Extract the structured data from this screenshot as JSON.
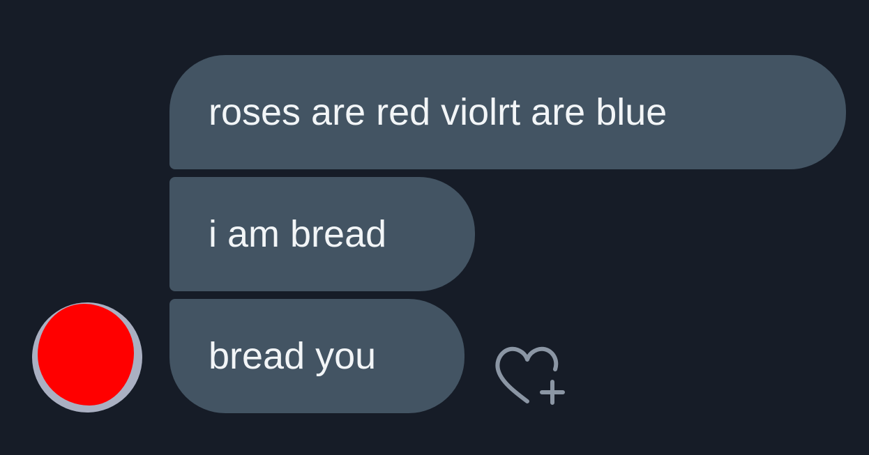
{
  "messages": [
    {
      "text": "roses are red violrt are blue"
    },
    {
      "text": "i am bread"
    },
    {
      "text": "bread you"
    }
  ],
  "avatar": {
    "color": "#ff0000"
  },
  "reaction": {
    "icon": "heart-plus-icon"
  },
  "colors": {
    "background": "#161c27",
    "bubble": "#435463",
    "text": "#f2f5f7",
    "icon": "#8b96a4"
  }
}
